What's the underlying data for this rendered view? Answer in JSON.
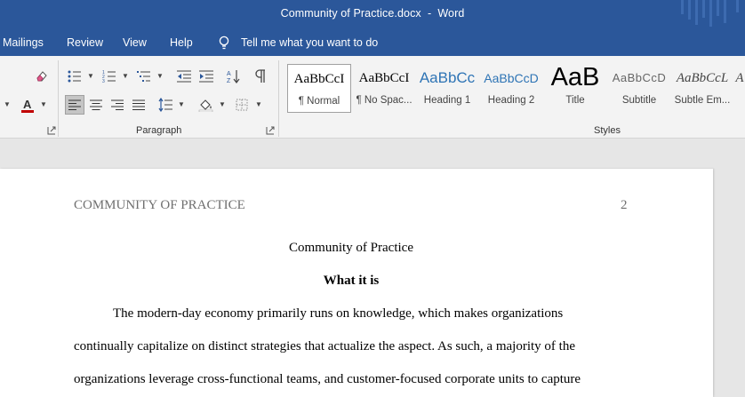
{
  "window": {
    "file_name": "Community of Practice.docx",
    "separator": "-",
    "app_name": "Word"
  },
  "menu": {
    "items": [
      "Mailings",
      "Review",
      "View",
      "Help"
    ],
    "tell_me": "Tell me what you want to do"
  },
  "ribbon": {
    "paragraph_label": "Paragraph",
    "styles_label": "Styles",
    "styles": [
      {
        "sample": "AaBbCcI",
        "name": "¶ Normal"
      },
      {
        "sample": "AaBbCcI",
        "name": "¶ No Spac..."
      },
      {
        "sample": "AaBbCc",
        "name": "Heading 1"
      },
      {
        "sample": "AaBbCcD",
        "name": "Heading 2"
      },
      {
        "sample": "AaB",
        "name": "Title"
      },
      {
        "sample": "AaBbCcD",
        "name": "Subtitle"
      },
      {
        "sample": "AaBbCcL",
        "name": "Subtle Em..."
      },
      {
        "sample": "A",
        "name": ""
      }
    ],
    "colors": {
      "font_color": "#c00000",
      "accent": "#2b579a"
    }
  },
  "document": {
    "header_left": "COMMUNITY OF PRACTICE",
    "page_number": "2",
    "title": "Community of Practice",
    "heading": "What it is",
    "lines": [
      "The modern-day economy primarily runs on knowledge, which makes organizations",
      "continually capitalize on distinct strategies that actualize the aspect. As such, a majority of the",
      "organizations leverage cross-functional teams, and customer-focused corporate units to capture"
    ]
  }
}
